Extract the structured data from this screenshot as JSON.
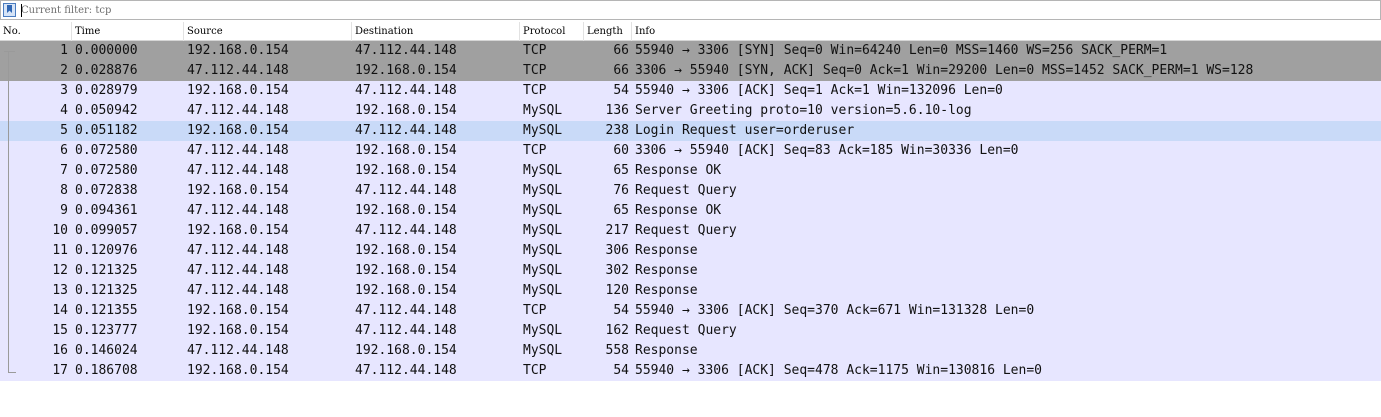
{
  "filter": {
    "text": "Current filter: tcp"
  },
  "columns": {
    "no": "No.",
    "time": "Time",
    "source": "Source",
    "destination": "Destination",
    "protocol": "Protocol",
    "length": "Length",
    "info": "Info"
  },
  "colors": {
    "syn_row": "#a0a0a0",
    "normal_row": "#e7e6ff",
    "selected_row": "#c9daf8"
  },
  "rows": [
    {
      "no": "1",
      "time": "0.000000",
      "source": "192.168.0.154",
      "destination": "47.112.44.148",
      "protocol": "TCP",
      "length": "66",
      "info": "55940 → 3306 [SYN] Seq=0 Win=64240 Len=0 MSS=1460 WS=256 SACK_PERM=1",
      "style": "syn"
    },
    {
      "no": "2",
      "time": "0.028876",
      "source": "47.112.44.148",
      "destination": "192.168.0.154",
      "protocol": "TCP",
      "length": "66",
      "info": "3306 → 55940 [SYN, ACK] Seq=0 Ack=1 Win=29200 Len=0 MSS=1452 SACK_PERM=1 WS=128",
      "style": "syn"
    },
    {
      "no": "3",
      "time": "0.028979",
      "source": "192.168.0.154",
      "destination": "47.112.44.148",
      "protocol": "TCP",
      "length": "54",
      "info": "55940 → 3306 [ACK] Seq=1 Ack=1 Win=132096 Len=0",
      "style": "normal"
    },
    {
      "no": "4",
      "time": "0.050942",
      "source": "47.112.44.148",
      "destination": "192.168.0.154",
      "protocol": "MySQL",
      "length": "136",
      "info": "Server Greeting proto=10 version=5.6.10-log",
      "style": "normal"
    },
    {
      "no": "5",
      "time": "0.051182",
      "source": "192.168.0.154",
      "destination": "47.112.44.148",
      "protocol": "MySQL",
      "length": "238",
      "info": "Login Request user=orderuser",
      "style": "sel"
    },
    {
      "no": "6",
      "time": "0.072580",
      "source": "47.112.44.148",
      "destination": "192.168.0.154",
      "protocol": "TCP",
      "length": "60",
      "info": "3306 → 55940 [ACK] Seq=83 Ack=185 Win=30336 Len=0",
      "style": "normal"
    },
    {
      "no": "7",
      "time": "0.072580",
      "source": "47.112.44.148",
      "destination": "192.168.0.154",
      "protocol": "MySQL",
      "length": "65",
      "info": "Response OK",
      "style": "normal"
    },
    {
      "no": "8",
      "time": "0.072838",
      "source": "192.168.0.154",
      "destination": "47.112.44.148",
      "protocol": "MySQL",
      "length": "76",
      "info": "Request Query",
      "style": "normal"
    },
    {
      "no": "9",
      "time": "0.094361",
      "source": "47.112.44.148",
      "destination": "192.168.0.154",
      "protocol": "MySQL",
      "length": "65",
      "info": "Response OK",
      "style": "normal"
    },
    {
      "no": "10",
      "time": "0.099057",
      "source": "192.168.0.154",
      "destination": "47.112.44.148",
      "protocol": "MySQL",
      "length": "217",
      "info": "Request Query",
      "style": "normal"
    },
    {
      "no": "11",
      "time": "0.120976",
      "source": "47.112.44.148",
      "destination": "192.168.0.154",
      "protocol": "MySQL",
      "length": "306",
      "info": "Response",
      "style": "normal"
    },
    {
      "no": "12",
      "time": "0.121325",
      "source": "47.112.44.148",
      "destination": "192.168.0.154",
      "protocol": "MySQL",
      "length": "302",
      "info": "Response",
      "style": "normal"
    },
    {
      "no": "13",
      "time": "0.121325",
      "source": "47.112.44.148",
      "destination": "192.168.0.154",
      "protocol": "MySQL",
      "length": "120",
      "info": "Response",
      "style": "normal"
    },
    {
      "no": "14",
      "time": "0.121355",
      "source": "192.168.0.154",
      "destination": "47.112.44.148",
      "protocol": "TCP",
      "length": "54",
      "info": "55940 → 3306 [ACK] Seq=370 Ack=671 Win=131328 Len=0",
      "style": "normal"
    },
    {
      "no": "15",
      "time": "0.123777",
      "source": "192.168.0.154",
      "destination": "47.112.44.148",
      "protocol": "MySQL",
      "length": "162",
      "info": "Request Query",
      "style": "normal"
    },
    {
      "no": "16",
      "time": "0.146024",
      "source": "47.112.44.148",
      "destination": "192.168.0.154",
      "protocol": "MySQL",
      "length": "558",
      "info": "Response",
      "style": "normal"
    },
    {
      "no": "17",
      "time": "0.186708",
      "source": "192.168.0.154",
      "destination": "47.112.44.148",
      "protocol": "TCP",
      "length": "54",
      "info": "55940 → 3306 [ACK] Seq=478 Ack=1175 Win=130816 Len=0",
      "style": "normal"
    }
  ]
}
